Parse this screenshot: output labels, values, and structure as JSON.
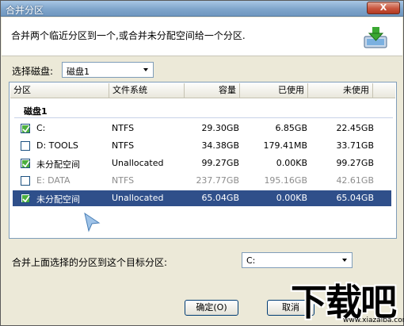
{
  "window": {
    "title": "合并分区",
    "close_label": "X"
  },
  "header": {
    "description": "合并两个临近分区到一个,或合并未分配空间给一个分区."
  },
  "disk_select": {
    "label": "选择磁盘:",
    "value": "磁盘1"
  },
  "table": {
    "columns": [
      "分区",
      "文件系统",
      "容量",
      "已使用",
      "未使用"
    ],
    "group": "磁盘1",
    "rows": [
      {
        "checked": true,
        "partition": "C:",
        "fs": "NTFS",
        "capacity": "29.30GB",
        "used": "6.85GB",
        "free": "22.45GB",
        "disabled": false,
        "selected": false
      },
      {
        "checked": false,
        "partition": "D:  TOOLS",
        "fs": "NTFS",
        "capacity": "34.38GB",
        "used": "179.41MB",
        "free": "33.71GB",
        "disabled": false,
        "selected": false
      },
      {
        "checked": true,
        "partition": "未分配空间",
        "fs": "Unallocated",
        "capacity": "99.27GB",
        "used": "0.00KB",
        "free": "99.27GB",
        "disabled": false,
        "selected": false
      },
      {
        "checked": false,
        "partition": "E:  DATA",
        "fs": "NTFS",
        "capacity": "237.77GB",
        "used": "195.16GB",
        "free": "42.61GB",
        "disabled": true,
        "selected": false
      },
      {
        "checked": true,
        "partition": "未分配空间",
        "fs": "Unallocated",
        "capacity": "65.04GB",
        "used": "0.00KB",
        "free": "65.04GB",
        "disabled": false,
        "selected": true
      }
    ]
  },
  "target": {
    "label": "合并上面选择的分区到这个目标分区:",
    "value": "C:"
  },
  "buttons": {
    "ok": "确定(O)",
    "cancel": "取消"
  },
  "watermark": {
    "logo": "下载吧",
    "url": "www.xiazaiba.com"
  },
  "icons": {
    "header": "merge-partition-icon",
    "close": "close-icon",
    "dropdown": "chevron-down-icon",
    "check": "checkmark-icon",
    "cursor": "mouse-pointer-icon"
  }
}
